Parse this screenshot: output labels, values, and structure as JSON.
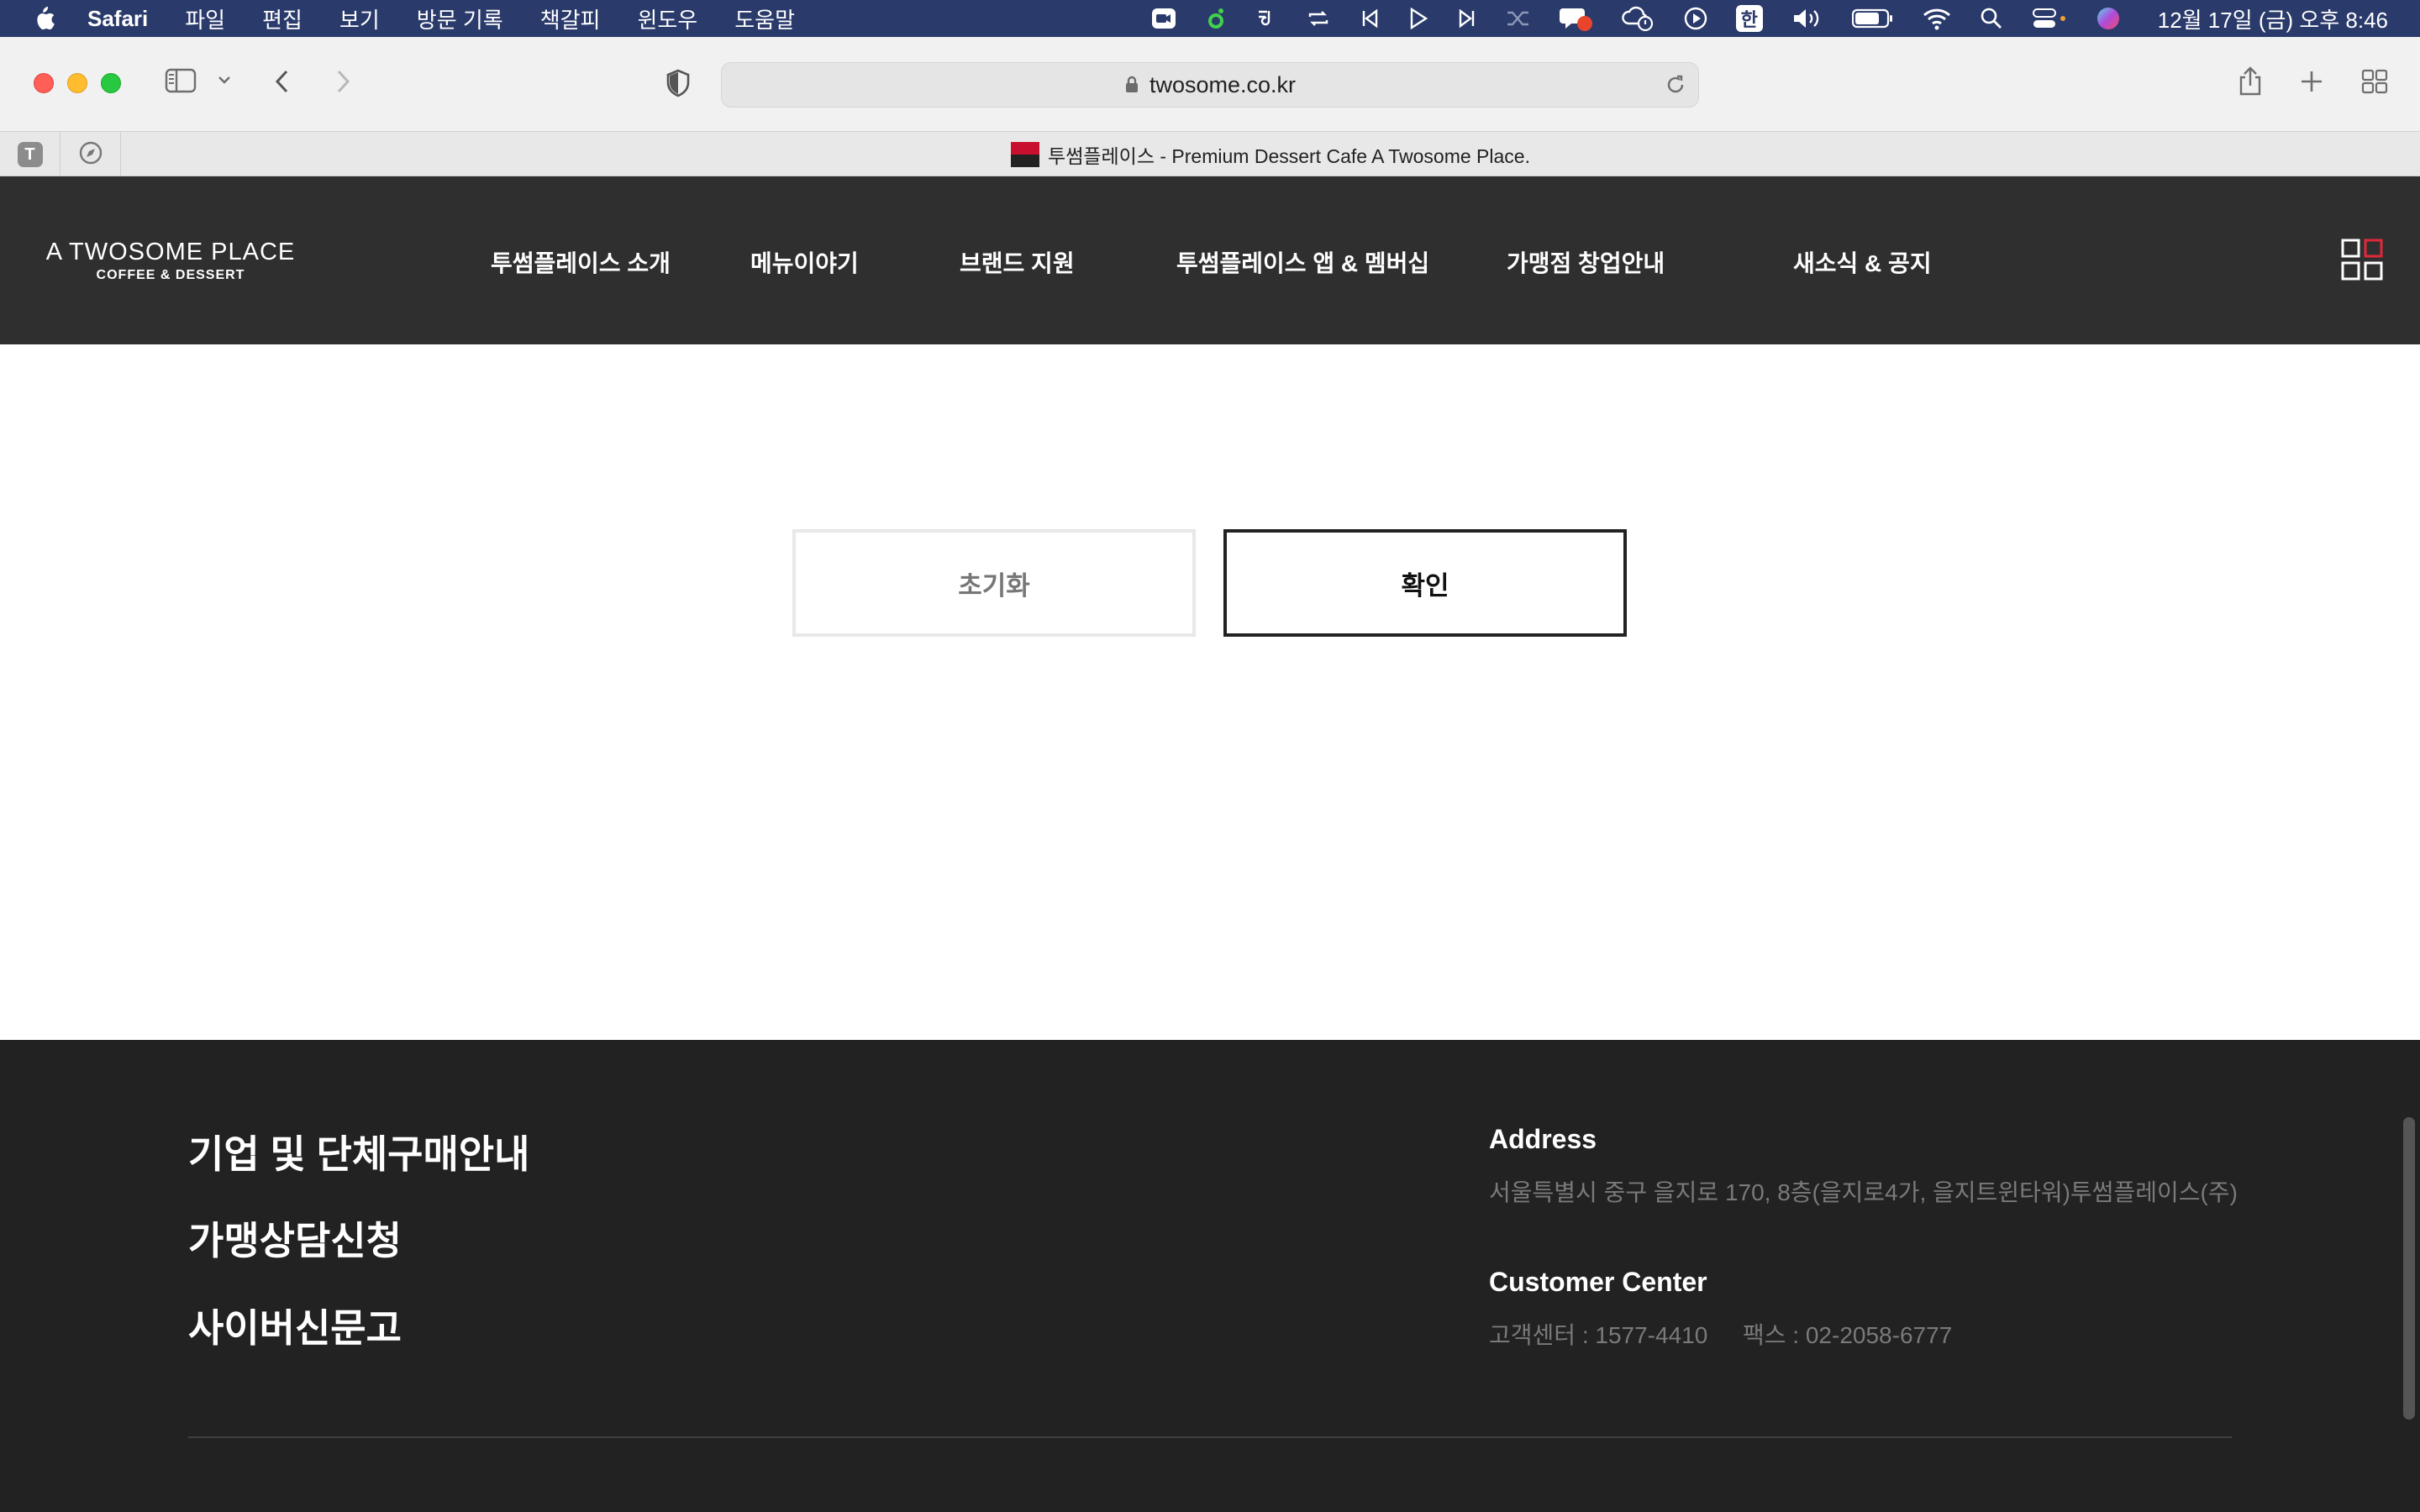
{
  "menubar": {
    "app_name": "Safari",
    "menus": [
      "파일",
      "편집",
      "보기",
      "방문 기록",
      "책갈피",
      "윈도우",
      "도움말"
    ],
    "clock": "12월 17일 (금) 오후 8:46",
    "input_method": "한"
  },
  "browser": {
    "url": "twosome.co.kr",
    "tab_title": "투썸플레이스 - Premium Dessert Cafe A Twosome Place.",
    "pinned_tab_letter": "T"
  },
  "header": {
    "logo_line1": "A TWOSOME PLACE",
    "logo_line2": "COFFEE & DESSERT",
    "nav": [
      "투썸플레이스 소개",
      "메뉴이야기",
      "브랜드 지원",
      "투썸플레이스 앱 & 멤버십",
      "가맹점 창업안내",
      "새소식 & 공지"
    ]
  },
  "form_actions": {
    "reset_label": "초기화",
    "confirm_label": "확인"
  },
  "footer": {
    "links": [
      "기업 및 단체구매안내",
      "가맹상담신청",
      "사이버신문고"
    ],
    "address_title": "Address",
    "address_text": "서울특별시 중구 을지로 170, 8층(을지로4가, 을지트윈타워)투썸플레이스(주)",
    "customer_title": "Customer Center",
    "phone": "고객센터 : 1577-4410",
    "fax": "팩스 : 02-2058-6777"
  },
  "colors": {
    "header_bg": "#2f2f2f",
    "footer_bg": "#222222",
    "brand_red": "#c8102e"
  }
}
